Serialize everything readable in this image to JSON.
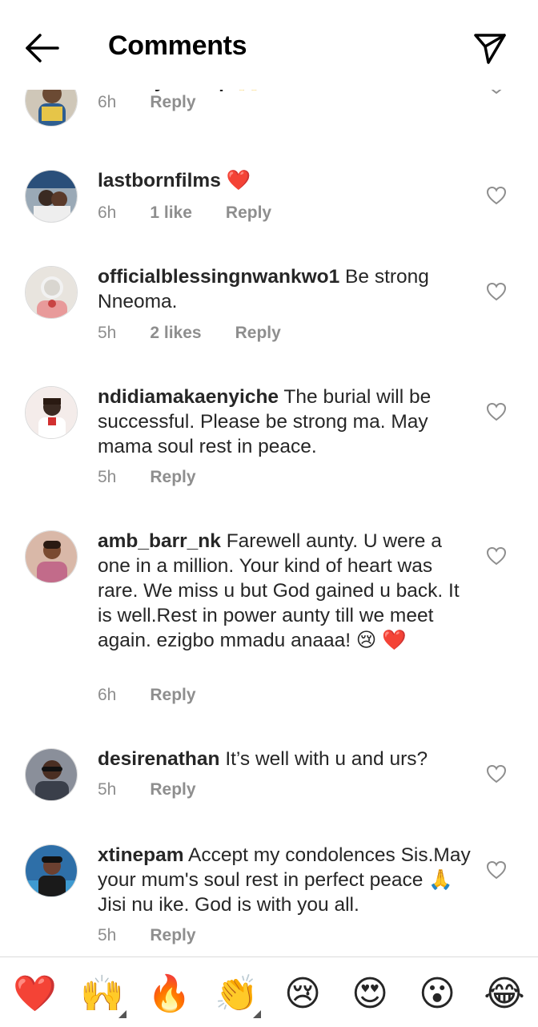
{
  "header": {
    "title": "Comments"
  },
  "comments": [
    {
      "username": "stanley_ontop",
      "text": "🙌",
      "time": "6h",
      "likes": "",
      "reply": "Reply"
    },
    {
      "username": "lastbornfilms",
      "text": "❤️",
      "time": "6h",
      "likes": "1 like",
      "reply": "Reply"
    },
    {
      "username": "officialblessingnwankwo1",
      "text": "Be strong Nneoma.",
      "time": "5h",
      "likes": "2 likes",
      "reply": "Reply"
    },
    {
      "username": "ndidiamakaenyiche",
      "text": "The burial will be successful. Please be strong ma. May mama soul rest in peace.",
      "time": "5h",
      "likes": "",
      "reply": "Reply"
    },
    {
      "username": "amb_barr_nk",
      "text": "Farewell aunty. U were a one in a million. Your kind of heart was rare. We miss u but God gained u back. It is well.Rest in power aunty till we meet again. ezigbo mmadu anaaa! 😢 ❤️",
      "time": "6h",
      "likes": "",
      "reply": "Reply"
    },
    {
      "username": "desirenathan",
      "text": "It’s well with u and urs?",
      "time": "5h",
      "likes": "",
      "reply": "Reply"
    },
    {
      "username": "xtinepam",
      "text": "Accept my condolences Sis.May your mum's soul rest in perfect peace 🙏 Jisi nu ike. God is with you all.",
      "time": "5h",
      "likes": "",
      "reply": "Reply"
    }
  ],
  "emoji_bar": [
    {
      "glyph": "❤️",
      "icon": "red-heart-emoji",
      "has_variants": false
    },
    {
      "glyph": "🙌",
      "icon": "raising-hands-emoji",
      "has_variants": true
    },
    {
      "glyph": "🔥",
      "icon": "fire-emoji",
      "has_variants": false
    },
    {
      "glyph": "👏",
      "icon": "clapping-hands-emoji",
      "has_variants": true
    },
    {
      "glyph": "😢",
      "icon": "crying-face-emoji",
      "has_variants": false
    },
    {
      "glyph": "😍",
      "icon": "heart-eyes-emoji",
      "has_variants": false
    },
    {
      "glyph": "😮",
      "icon": "surprised-face-emoji",
      "has_variants": false
    },
    {
      "glyph": "😂",
      "icon": "tears-of-joy-emoji",
      "has_variants": false
    }
  ],
  "colors": {
    "text": "#262626",
    "muted": "#8e8e8e",
    "divider": "#dbdbdb",
    "heart_red": "#ed4956"
  }
}
